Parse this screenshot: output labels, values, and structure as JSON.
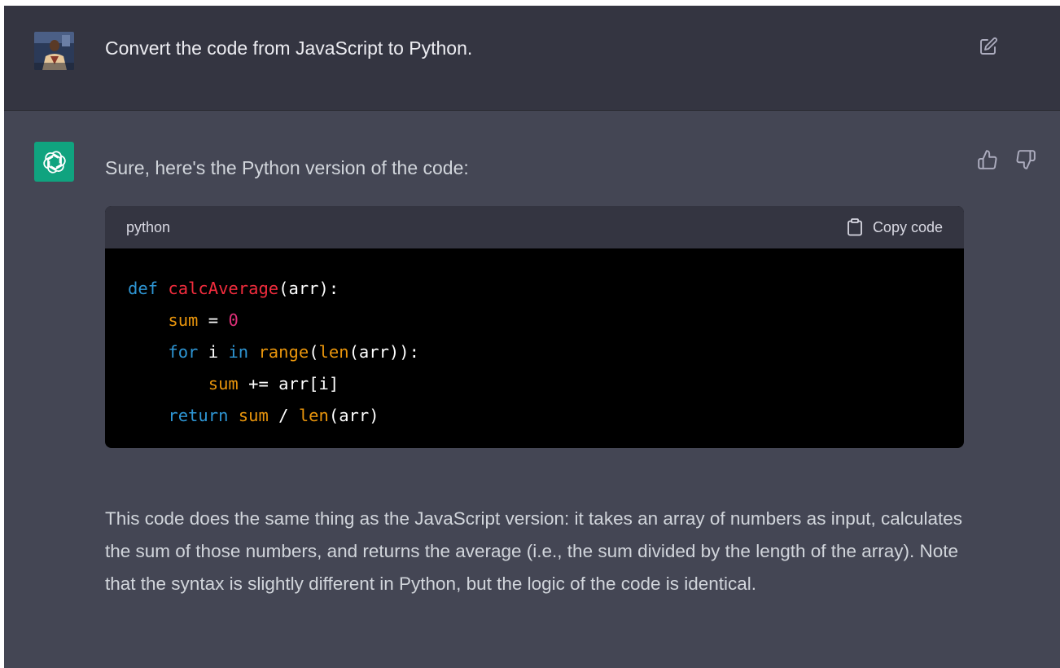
{
  "user_message": {
    "text": "Convert the code from JavaScript to Python."
  },
  "assistant_message": {
    "intro": "Sure, here's the Python version of the code:",
    "code_block": {
      "language": "python",
      "copy_label": "Copy code",
      "lines": [
        [
          {
            "t": "def",
            "c": "kw"
          },
          {
            "t": " "
          },
          {
            "t": "calcAverage",
            "c": "fn"
          },
          {
            "t": "(arr):"
          }
        ],
        [
          {
            "t": "    "
          },
          {
            "t": "sum",
            "c": "var"
          },
          {
            "t": " = "
          },
          {
            "t": "0",
            "c": "num"
          }
        ],
        [
          {
            "t": "    "
          },
          {
            "t": "for",
            "c": "kw"
          },
          {
            "t": " i "
          },
          {
            "t": "in",
            "c": "kw"
          },
          {
            "t": " "
          },
          {
            "t": "range",
            "c": "bi"
          },
          {
            "t": "("
          },
          {
            "t": "len",
            "c": "bi"
          },
          {
            "t": "(arr)):"
          }
        ],
        [
          {
            "t": "        "
          },
          {
            "t": "sum",
            "c": "var"
          },
          {
            "t": " += arr[i]"
          }
        ],
        [
          {
            "t": "    "
          },
          {
            "t": "return",
            "c": "kw"
          },
          {
            "t": " "
          },
          {
            "t": "sum",
            "c": "var"
          },
          {
            "t": " / "
          },
          {
            "t": "len",
            "c": "bi"
          },
          {
            "t": "(arr)"
          }
        ]
      ]
    },
    "explanation": "This code does the same thing as the JavaScript version: it takes an array of numbers as input, calculates the sum of those numbers, and returns the average (i.e., the sum divided by the length of the array). Note that the syntax is slightly different in Python, but the logic of the code is identical."
  },
  "icons": {
    "edit": "edit-icon",
    "thumbs_up": "thumbs-up-icon",
    "thumbs_down": "thumbs-down-icon",
    "copy": "clipboard-icon",
    "logo": "openai-logo-icon"
  },
  "colors": {
    "user_bg": "#343541",
    "assistant_bg": "#444654",
    "logo_bg": "#10a37f",
    "code_bg": "#000000",
    "keyword": "#2e95d3",
    "function": "#f22c3d",
    "variable": "#e9950c",
    "number": "#df3079"
  }
}
